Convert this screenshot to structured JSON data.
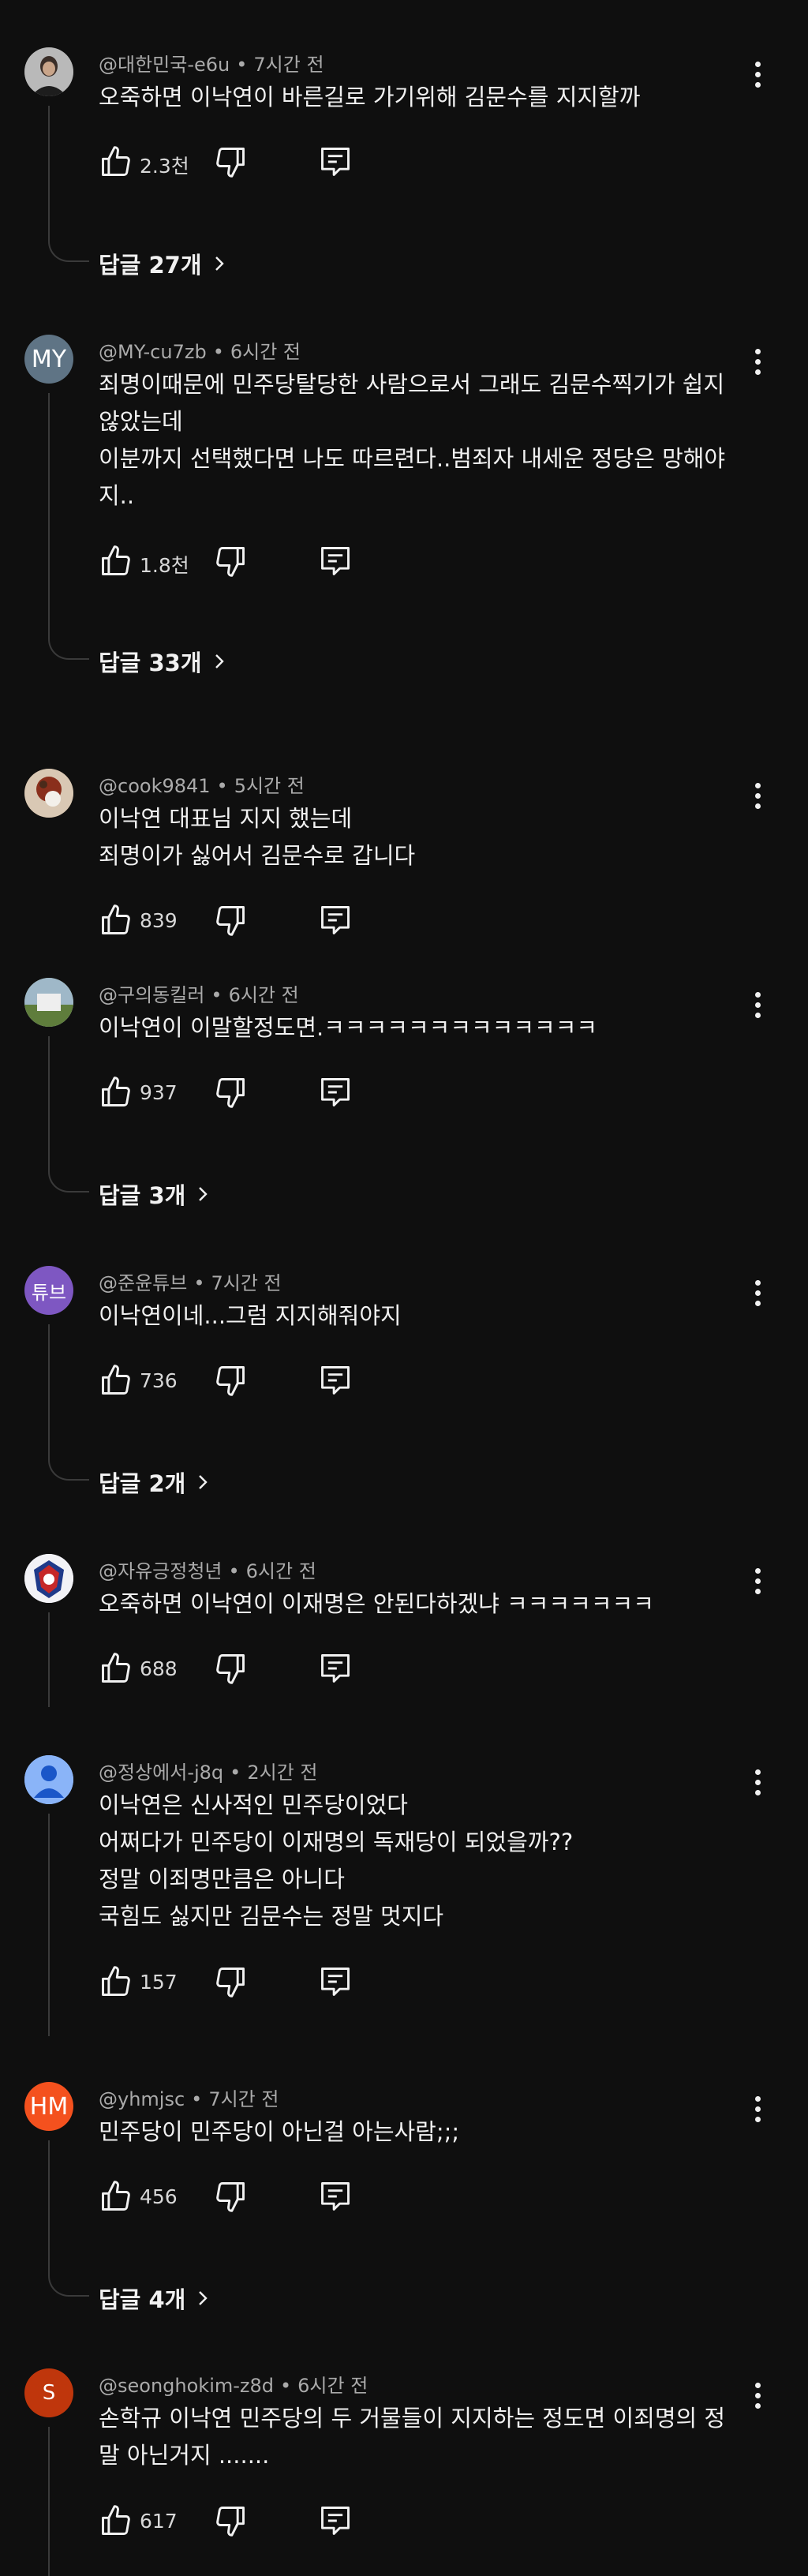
{
  "comments": [
    {
      "author": "@대한민국-e6u",
      "time": "7시간 전",
      "avatar_text": "",
      "avatar_color": "#6b6b6b",
      "lines": [
        "오죽하면 이낙연이 바른길로 가기위해 김문수를 지지할까"
      ],
      "likes": "2.3천",
      "replies": "답글 27개"
    },
    {
      "author": "@MY-cu7zb",
      "time": "6시간 전",
      "avatar_text": "MY",
      "avatar_color": "#5f7485",
      "lines": [
        "죄명이때문에 민주당탈당한 사람으로서 그래도 김문수찍기가 쉽지",
        "않았는데",
        "이분까지 선택했다면  나도 따르련다..범죄자 내세운 정당은 망해야",
        "지.."
      ],
      "likes": "1.8천",
      "replies": "답글 33개"
    },
    {
      "author": "@cook9841",
      "time": "5시간 전",
      "avatar_text": "",
      "avatar_color": "#7a5a3c",
      "lines": [
        "이낙연 대표님 지지 했는데",
        "죄명이가 싫어서 김문수로 갑니다"
      ],
      "likes": "839",
      "replies": ""
    },
    {
      "author": "@구의동킬러",
      "time": "6시간 전",
      "avatar_text": "",
      "avatar_color": "#6f8a5a",
      "lines": [
        "이낙연이 이말할정도면.ㅋㅋㅋㅋㅋㅋㅋㅋㅋㅋㅋㅋㅋ"
      ],
      "likes": "937",
      "replies": "답글 3개"
    },
    {
      "author": "@준윤튜브",
      "time": "7시간 전",
      "avatar_text": "튜브",
      "avatar_color": "#7e57c2",
      "lines": [
        "이낙연이네...그럼 지지해줘야지"
      ],
      "likes": "736",
      "replies": "답글 2개"
    },
    {
      "author": "@자유긍정청년",
      "time": "6시간 전",
      "avatar_text": "",
      "avatar_color": "#d8d8e8",
      "lines": [
        "오죽하면 이낙연이 이재명은 안된다하겠냐 ㅋㅋㅋㅋㅋㅋㅋ"
      ],
      "likes": "688",
      "replies": ""
    },
    {
      "author": "@정상에서-j8q",
      "time": "2시간 전",
      "avatar_text": "",
      "avatar_color": "#8ab4f8",
      "lines": [
        "이낙연은 신사적인 민주당이었다",
        "어쩌다가 민주당이 이재명의 독재당이 되었을까??",
        "정말 이죄명만큼은 아니다",
        "국힘도 싫지만 김문수는 정말 멋지다"
      ],
      "likes": "157",
      "replies": ""
    },
    {
      "author": "@yhmjsc",
      "time": "7시간 전",
      "avatar_text": "HM",
      "avatar_color": "#f4511e",
      "lines": [
        "민주당이 민주당이 아닌걸 아는사람;;;"
      ],
      "likes": "456",
      "replies": "답글 4개"
    },
    {
      "author": "@seonghokim-z8d",
      "time": "6시간 전",
      "avatar_text": "S",
      "avatar_color": "#bf360c",
      "lines": [
        "손학규 이낙연  민주당의 두 거물들이 지지하는 정도면 이죄명의 정",
        "말 아닌거지 ......."
      ],
      "likes": "617",
      "replies": ""
    }
  ]
}
